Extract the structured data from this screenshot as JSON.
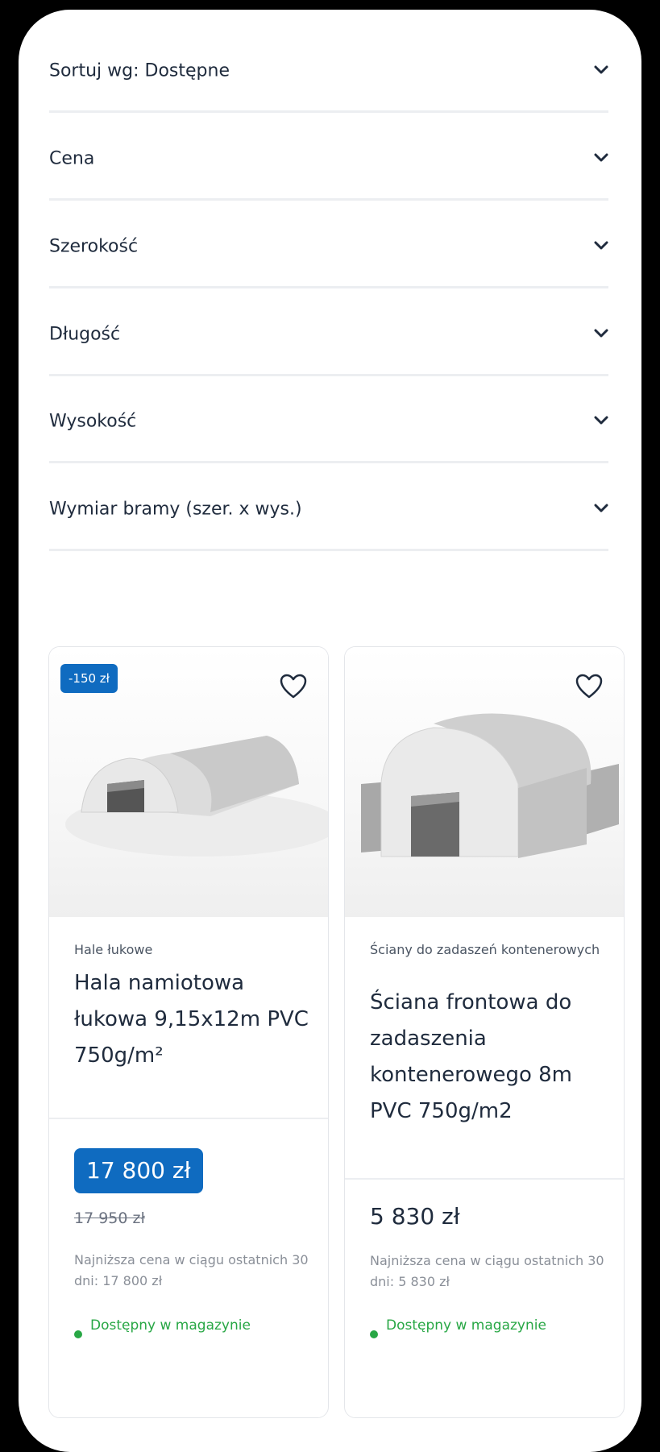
{
  "filters": [
    {
      "label": "Sortuj wg: Dostępne"
    },
    {
      "label": "Cena"
    },
    {
      "label": "Szerokość"
    },
    {
      "label": "Długość"
    },
    {
      "label": "Wysokość"
    },
    {
      "label": "Wymiar bramy (szer. x wys.)"
    }
  ],
  "products": [
    {
      "badge": "-150 zł",
      "category": "Hale łukowe",
      "title": "Hala namiotowa łukowa 9,15x12m PVC 750g/m²",
      "price": "17 800 zł",
      "old_price": "17 950 zł",
      "lowest_price_note": "Najniższa cena w ciągu ostatnich 30 dni: 17 800 zł",
      "stock": "Dostępny w magazynie",
      "icon": "heart-icon"
    },
    {
      "category": "Ściany do zadaszeń kontenerowych",
      "title": "Ściana frontowa do zadaszenia kontenerowego 8m PVC 750g/m2",
      "price": "5 830 zł",
      "lowest_price_note": "Najniższa cena w ciągu ostatnich 30 dni: 5 830 zł",
      "stock": "Dostępny w magazynie",
      "icon": "heart-icon"
    }
  ],
  "colors": {
    "accent": "#0f6bc0",
    "in_stock": "#28a745",
    "text": "#1f2b3d"
  }
}
